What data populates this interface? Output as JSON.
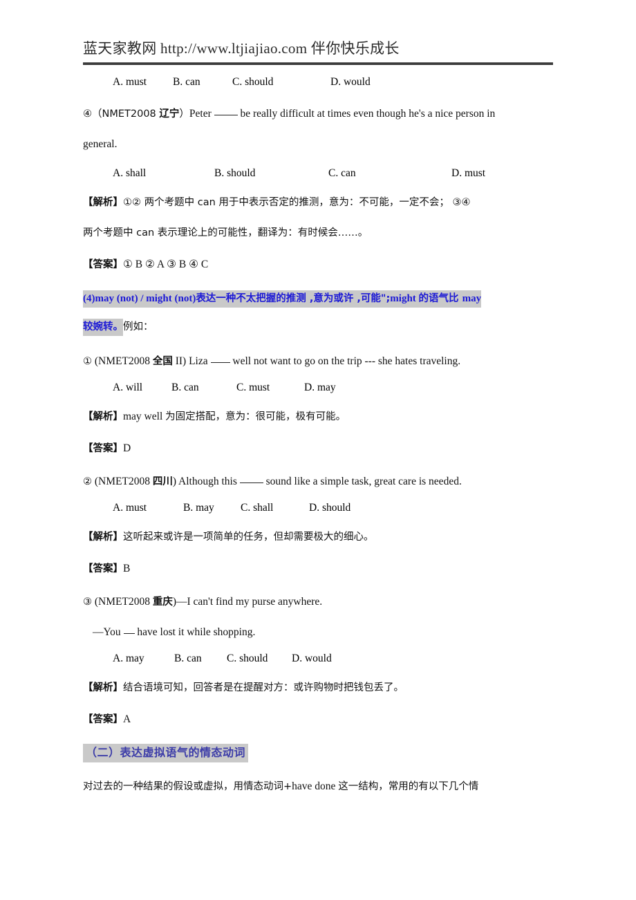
{
  "header": {
    "site_name": "蓝天家教网",
    "url": "http://www.ltjiajiao.com",
    "slogan": "伴你快乐成长",
    "full_text": "蓝天家教网  http://www.ltjiajiao.com  伴你快乐成长"
  },
  "colors": {
    "highlight_bg": "#c9c9c9",
    "highlight_text": "#1c19d6",
    "section_head_text": "#3b3ba8",
    "body_text": "#111111",
    "rule": "#3a3a3a"
  },
  "content": {
    "q_prev_options": {
      "a": "A. must",
      "b": "B. can",
      "c": "C. should",
      "d": "D. would"
    },
    "q4": {
      "marker": "④",
      "source_open": "（NMET2008 ",
      "source_region": "辽宁",
      "source_close": "）",
      "stem_before": "Peter ",
      "stem_after": " be really difficult at times even though he's a nice person in",
      "stem_line2": "general.",
      "options": {
        "a": "A. shall",
        "b": "B. should",
        "c": "C. can",
        "d": "D. must"
      }
    },
    "analysis_1": {
      "label": "【解析】",
      "line1": "①②  两个考题中 can 用于中表示否定的推测，意为：不可能，一定不会；  ③④",
      "line2": "两个考题中 can 表示理论上的可能性，翻译为：有时候会……。"
    },
    "answer_1": {
      "label": "【答案】",
      "value": "①  B  ②  A   ③  B  ④  C"
    },
    "rule4_highlight": {
      "line1_en_a": "(4)may (not) / might (not)",
      "line1_cn_a": "表达一种不太把握的推测 ,意为或许 ,可能\";",
      "line1_en_b": "might ",
      "line1_cn_b": "的语气比 ",
      "line1_en_c": "may",
      "line2_hl": "较婉转。",
      "line2_plain": "例如："
    },
    "q1": {
      "marker": "①",
      "source_open": "(NMET2008 ",
      "source_region": "全国",
      "source_close": " II)",
      "stem_before": " Liza ",
      "stem_after": " well not want to go on the trip --- she hates traveling.",
      "options": {
        "a": "A. will",
        "b": "B. can",
        "c": "C. must",
        "d": "D. may"
      },
      "analysis_label": "【解析】",
      "analysis_text_en": "may well ",
      "analysis_text_cn": "为固定搭配，意为：很可能，极有可能。",
      "answer_label": "【答案】",
      "answer_value": "D"
    },
    "q2": {
      "marker": "②",
      "source_open": "(NMET2008 ",
      "source_region": "四川",
      "source_close": ")",
      "stem_before": " Although this ",
      "stem_after": " sound like a simple task, great care is needed.",
      "options": {
        "a": "A. must",
        "b": "B. may",
        "c": "C. shall",
        "d": "D. should"
      },
      "analysis_label": "【解析】",
      "analysis_text": "这听起来或许是一项简单的任务，但却需要极大的细心。",
      "answer_label": "【答案】",
      "answer_value": "B"
    },
    "q3": {
      "marker": "③",
      "source_open": "(NMET2008 ",
      "source_region": "重庆",
      "source_close": ")",
      "stem_line1": "—I can't find my purse anywhere.",
      "stem_line2_before": "—You ",
      "stem_line2_after": " have lost it while shopping.",
      "options": {
        "a": "A. may",
        "b": "B. can",
        "c": "C. should",
        "d": "D. would"
      },
      "analysis_label": "【解析】",
      "analysis_text": "结合语境可知，回答者是在提醒对方：或许购物时把钱包丢了。",
      "answer_label": "【答案】",
      "answer_value": "A"
    },
    "section2": {
      "heading": "（二）表达虚拟语气的情态动词",
      "body_cn_a": "对过去的一种结果的假设或虚拟，用情态动词+",
      "body_en": "have done ",
      "body_cn_b": "这一结构，常用的有以下几个情"
    }
  }
}
